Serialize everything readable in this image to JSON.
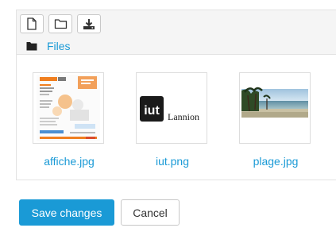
{
  "filemanager": {
    "toolbar": {
      "buttons": [
        {
          "icon": "new-file-icon"
        },
        {
          "icon": "folder-icon"
        },
        {
          "icon": "download-icon"
        }
      ]
    },
    "breadcrumb": {
      "icon": "folder-icon",
      "label": "Files"
    },
    "files": [
      {
        "name": "affiche.jpg",
        "thumb": "poster-thumbnail"
      },
      {
        "name": "iut.png",
        "thumb": "iut-lannion-logo-thumbnail",
        "logo_text": "iut",
        "caption": "Lannion"
      },
      {
        "name": "plage.jpg",
        "thumb": "beach-photo-thumbnail"
      }
    ]
  },
  "actions": {
    "save_label": "Save changes",
    "cancel_label": "Cancel"
  },
  "colors": {
    "accent": "#1a9ad6",
    "border": "#e3e3e3",
    "header_bg": "#f5f5f5"
  }
}
